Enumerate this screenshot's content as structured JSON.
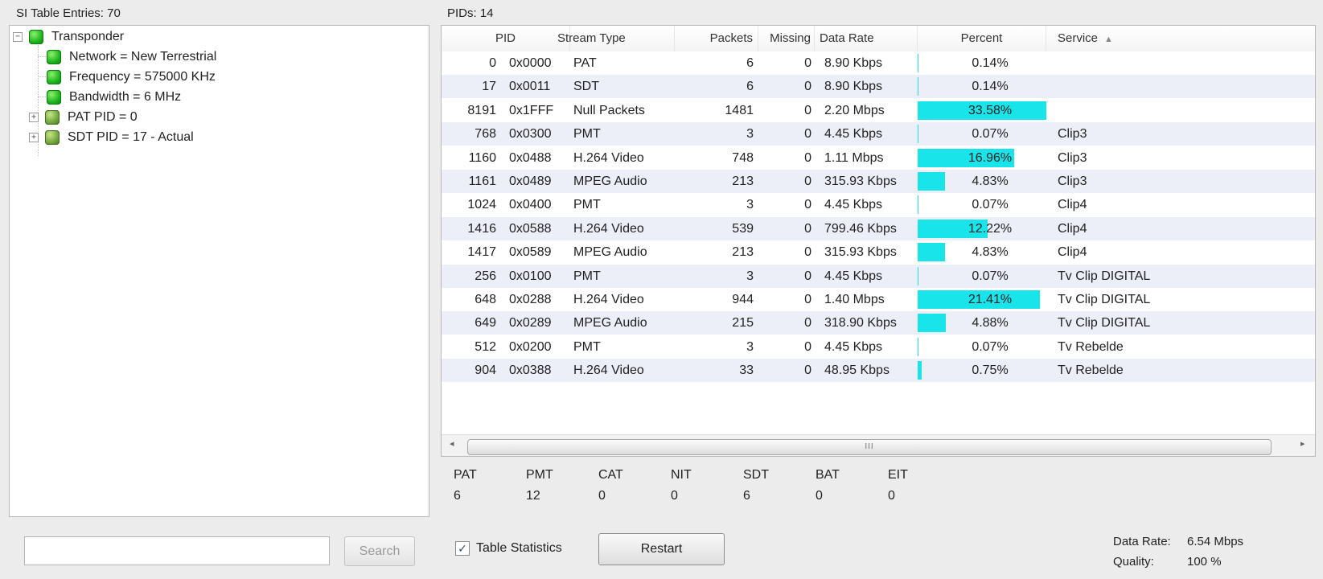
{
  "left": {
    "title": "SI Table Entries: 70",
    "tree": {
      "root": {
        "label": "Transponder",
        "expander": "−"
      },
      "children": [
        {
          "label": "Network = New Terrestrial"
        },
        {
          "label": "Frequency = 575000 KHz"
        },
        {
          "label": "Bandwidth = 6 MHz"
        },
        {
          "label": "PAT PID = 0",
          "expander": "+"
        },
        {
          "label": "SDT PID = 17 - Actual",
          "expander": "+"
        }
      ]
    },
    "search": {
      "placeholder": "",
      "button_label": "Search"
    }
  },
  "right": {
    "title": "PIDs: 14",
    "columns": {
      "pid": "PID",
      "stream_type": "Stream Type",
      "packets": "Packets",
      "missing": "Missing",
      "data_rate": "Data Rate",
      "percent": "Percent",
      "service": "Service"
    },
    "sort_indicator": "▲",
    "rows": [
      {
        "pid": "0",
        "hex": "0x0000",
        "type": "PAT",
        "packets": "6",
        "missing": "0",
        "rate": "8.90 Kbps",
        "percent": "0.14%",
        "percent_value": 0.14,
        "service": ""
      },
      {
        "pid": "17",
        "hex": "0x0011",
        "type": "SDT",
        "packets": "6",
        "missing": "0",
        "rate": "8.90 Kbps",
        "percent": "0.14%",
        "percent_value": 0.14,
        "service": ""
      },
      {
        "pid": "8191",
        "hex": "0x1FFF",
        "type": "Null Packets",
        "packets": "1481",
        "missing": "0",
        "rate": "2.20 Mbps",
        "percent": "33.58%",
        "percent_value": 33.58,
        "service": ""
      },
      {
        "pid": "768",
        "hex": "0x0300",
        "type": "PMT",
        "packets": "3",
        "missing": "0",
        "rate": "4.45 Kbps",
        "percent": "0.07%",
        "percent_value": 0.07,
        "service": "Clip3"
      },
      {
        "pid": "1160",
        "hex": "0x0488",
        "type": "H.264 Video",
        "packets": "748",
        "missing": "0",
        "rate": "1.11 Mbps",
        "percent": "16.96%",
        "percent_value": 16.96,
        "service": "Clip3"
      },
      {
        "pid": "1161",
        "hex": "0x0489",
        "type": "MPEG Audio",
        "packets": "213",
        "missing": "0",
        "rate": "315.93 Kbps",
        "percent": "4.83%",
        "percent_value": 4.83,
        "service": "Clip3"
      },
      {
        "pid": "1024",
        "hex": "0x0400",
        "type": "PMT",
        "packets": "3",
        "missing": "0",
        "rate": "4.45 Kbps",
        "percent": "0.07%",
        "percent_value": 0.07,
        "service": "Clip4"
      },
      {
        "pid": "1416",
        "hex": "0x0588",
        "type": "H.264 Video",
        "packets": "539",
        "missing": "0",
        "rate": "799.46 Kbps",
        "percent": "12.22%",
        "percent_value": 12.22,
        "service": "Clip4"
      },
      {
        "pid": "1417",
        "hex": "0x0589",
        "type": "MPEG Audio",
        "packets": "213",
        "missing": "0",
        "rate": "315.93 Kbps",
        "percent": "4.83%",
        "percent_value": 4.83,
        "service": "Clip4"
      },
      {
        "pid": "256",
        "hex": "0x0100",
        "type": "PMT",
        "packets": "3",
        "missing": "0",
        "rate": "4.45 Kbps",
        "percent": "0.07%",
        "percent_value": 0.07,
        "service": "Tv Clip DIGITAL"
      },
      {
        "pid": "648",
        "hex": "0x0288",
        "type": "H.264 Video",
        "packets": "944",
        "missing": "0",
        "rate": "1.40 Mbps",
        "percent": "21.41%",
        "percent_value": 21.41,
        "service": "Tv Clip DIGITAL"
      },
      {
        "pid": "649",
        "hex": "0x0289",
        "type": "MPEG Audio",
        "packets": "215",
        "missing": "0",
        "rate": "318.90 Kbps",
        "percent": "4.88%",
        "percent_value": 4.88,
        "service": "Tv Clip DIGITAL"
      },
      {
        "pid": "512",
        "hex": "0x0200",
        "type": "PMT",
        "packets": "3",
        "missing": "0",
        "rate": "4.45 Kbps",
        "percent": "0.07%",
        "percent_value": 0.07,
        "service": "Tv Rebelde"
      },
      {
        "pid": "904",
        "hex": "0x0388",
        "type": "H.264 Video",
        "packets": "33",
        "missing": "0",
        "rate": "48.95 Kbps",
        "percent": "0.75%",
        "percent_value": 0.75,
        "service": "Tv Rebelde"
      }
    ],
    "scrollbar": {
      "left_arrow": "◂",
      "right_arrow": "▸",
      "grip": "III"
    },
    "stats": [
      {
        "label": "PAT",
        "value": "6"
      },
      {
        "label": "PMT",
        "value": "12"
      },
      {
        "label": "CAT",
        "value": "0"
      },
      {
        "label": "NIT",
        "value": "0"
      },
      {
        "label": "SDT",
        "value": "6"
      },
      {
        "label": "BAT",
        "value": "0"
      },
      {
        "label": "EIT",
        "value": "0"
      }
    ],
    "table_statistics": {
      "label": "Table Statistics",
      "checked": true,
      "mark": "✓"
    },
    "restart_label": "Restart",
    "summary": {
      "data_rate_label": "Data Rate:",
      "data_rate_value": "6.54 Mbps",
      "quality_label": "Quality:",
      "quality_value": "100 %"
    }
  },
  "colors": {
    "percent_bar": "#19e4ea",
    "alt_row": "#eceef8",
    "node_green": "#19b21a"
  },
  "icons": {
    "tree_node": "green-node-icon",
    "expand": "plus-icon",
    "collapse": "minus-icon",
    "check": "check-icon"
  }
}
